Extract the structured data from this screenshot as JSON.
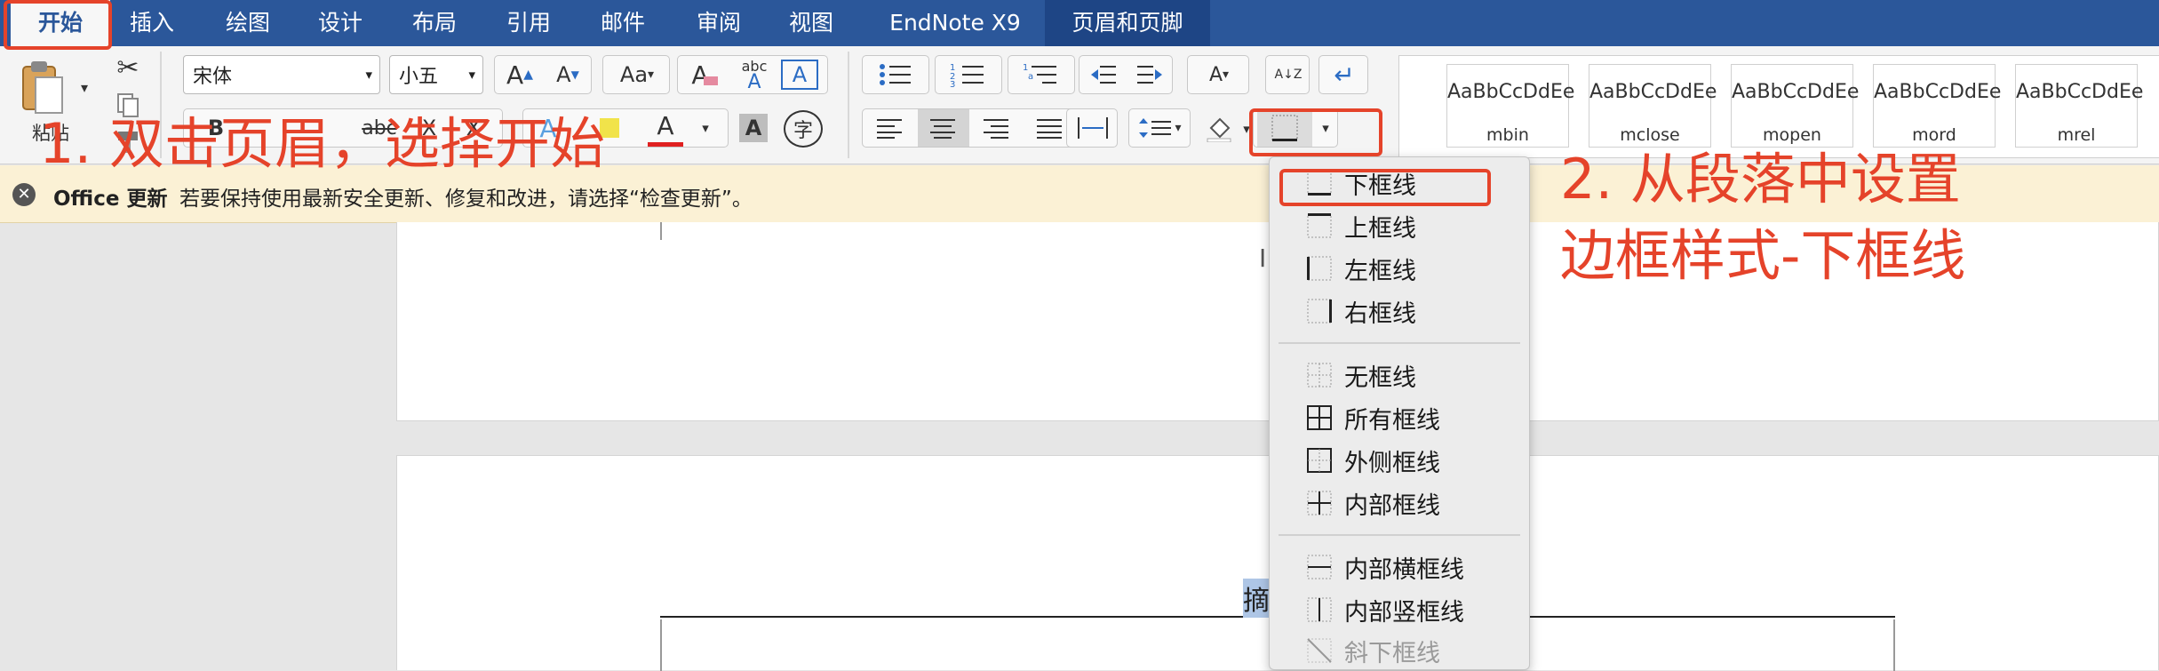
{
  "tabs": [
    "开始",
    "插入",
    "绘图",
    "设计",
    "布局",
    "引用",
    "邮件",
    "审阅",
    "视图",
    "EndNote X9",
    "页眉和页脚"
  ],
  "ribbon": {
    "paste_label": "粘贴",
    "font_name": "宋体",
    "font_size": "小五",
    "bold": "B",
    "strike": "abc",
    "subscript": "X",
    "superscript": "X",
    "phonetic": "字",
    "styles": [
      {
        "sample": "AaBbCcDdEe",
        "name": "mbin"
      },
      {
        "sample": "AaBbCcDdEe",
        "name": "mclose"
      },
      {
        "sample": "AaBbCcDdEe",
        "name": "mopen"
      },
      {
        "sample": "AaBbCcDdEe",
        "name": "mord"
      },
      {
        "sample": "AaBbCcDdEe",
        "name": "mrel"
      }
    ]
  },
  "notification": {
    "title": "Office 更新",
    "message": "若要保持使用最新安全更新、修复和改进，请选择“检查更新”。"
  },
  "document": {
    "cursor_char": "I",
    "selected_text": "摘"
  },
  "border_menu": {
    "group1": [
      "下框线",
      "上框线",
      "左框线",
      "右框线"
    ],
    "group2": [
      "无框线",
      "所有框线",
      "外侧框线",
      "内部框线"
    ],
    "group3": [
      "内部横框线",
      "内部竖框线",
      "斜下框线"
    ]
  },
  "annotations": {
    "step1": "1. 双击页眉，选择开始",
    "step2_line1": "2. 从段落中设置",
    "step2_line2": "边框样式-下框线"
  },
  "colors": {
    "tabbar": "#2b579a",
    "annotation": "#e5432a",
    "notification_bg": "#fbf1d5"
  }
}
